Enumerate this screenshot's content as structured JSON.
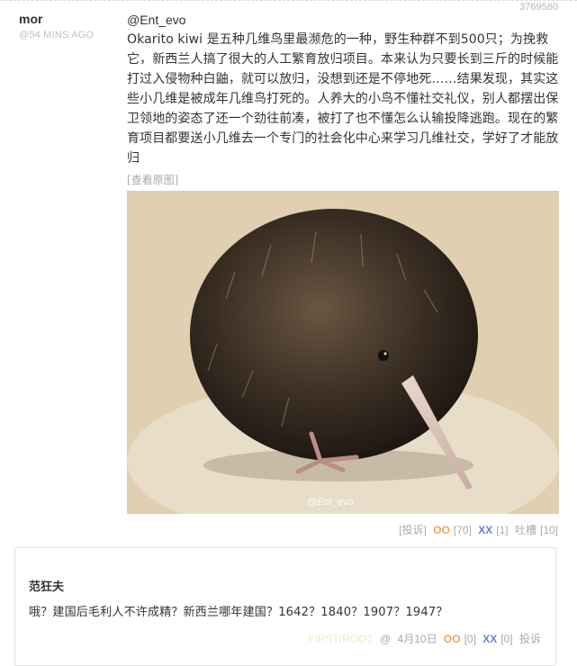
{
  "post": {
    "id": "3769580",
    "author": "mor",
    "time": "@54 MINS AGO",
    "mention": "@Ent_evo",
    "text": "Okarito kiwi 是五种几维鸟里最濒危的一种，野生种群不到500只；为挽救它，新西兰人搞了很大的人工繁育放归项目。本来认为只要长到三斤的时候能打过入侵物种白鼬，就可以放归，没想到还是不停地死……结果发现，其实这些小几维是被成年几维鸟打死的。人养大的小鸟不懂社交礼仪，别人都摆出保卫领地的姿态了还一个劲往前凑，被打了也不懂怎么认输投降逃跑。现在的繁育项目都要送小几维去一个专门的社会化中心来学习几维社交，学好了才能放归",
    "view_original": "[查看原图]",
    "image_watermark": "@Ent_evo",
    "report": "[投诉]",
    "oo_label": "OO",
    "oo_count": "[70]",
    "xx_label": "XX",
    "xx_count": "[1]",
    "tucao": "吐槽",
    "tucao_count": "[10]"
  },
  "comment": {
    "author": "范狂夫",
    "text": "哦？建国后毛利人不许成精？新西兰哪年建国？1642？1840？1907？1947？",
    "ghost": "FIRST/ROOT",
    "at": "@",
    "date": "4月10日",
    "oo_label": "OO",
    "oo_count": "[0]",
    "xx_label": "XX",
    "xx_count": "[0]",
    "report": "投诉"
  }
}
